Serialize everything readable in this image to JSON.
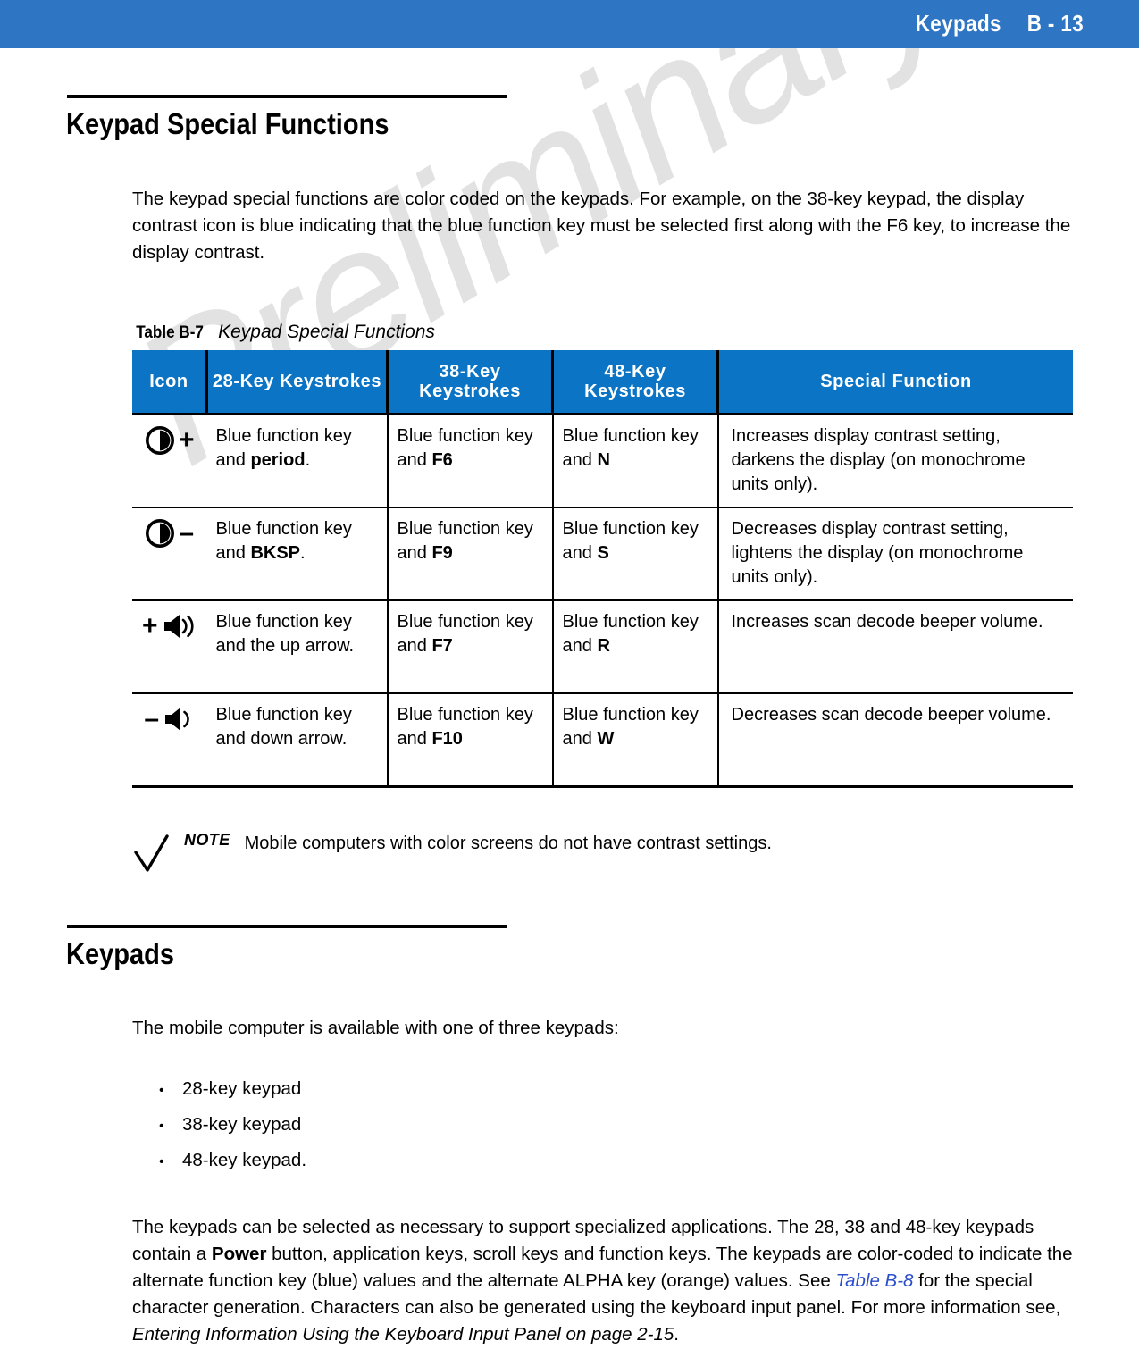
{
  "header": {
    "title": "Keypads",
    "page_number": "B - 13",
    "bar_color": "#2e76c4"
  },
  "watermark": {
    "text": "Preliminary"
  },
  "sections": {
    "special_functions": {
      "heading": "Keypad Special Functions",
      "intro": "The keypad special functions are color coded on the keypads. For example, on the 38-key keypad, the display contrast icon is blue indicating that the blue function key must be selected first along with the F6 key, to increase the display contrast."
    },
    "keypads": {
      "heading": "Keypads",
      "intro": "The mobile computer is available with one of three keypads:",
      "bullets": [
        "28-key keypad",
        "38-key keypad",
        "48-key keypad."
      ],
      "closing": {
        "part1": "The keypads can be selected as necessary to support specialized applications. The 28, 38 and 48-key keypads contain a ",
        "bold1": "Power",
        "part2": " button, application keys, scroll keys and function keys. The keypads are color-coded to indicate the alternate function key (blue) values and the alternate ALPHA key (orange) values. See ",
        "link1": "Table B-8",
        "part3": " for the special character generation. Characters can also be generated using the keyboard input panel. For more information see, ",
        "italic1": "Entering Information Using the Keyboard Input Panel on page 2-15",
        "part4": "."
      }
    }
  },
  "table": {
    "caption_label": "Table B-7",
    "caption_title": "Keypad Special Functions",
    "header_color": "#0b74c4",
    "columns": [
      "Icon",
      "28-Key Keystrokes",
      "38-Key Keystrokes",
      "48-Key Keystrokes",
      "Special Function"
    ],
    "rows": [
      {
        "icon_name": "contrast-increase-icon",
        "icon_sign": "+",
        "icon_sign_position": "right",
        "icon_kind": "contrast",
        "key28_prefix": "Blue function key and ",
        "key28_bold": "period",
        "key28_suffix": ".",
        "key38_prefix": "Blue function key and ",
        "key38_bold": "F6",
        "key38_suffix": "",
        "key48_prefix": "Blue function key and ",
        "key48_bold": "N",
        "key48_suffix": "",
        "function": "Increases display contrast setting, darkens the display (on monochrome units only)."
      },
      {
        "icon_name": "contrast-decrease-icon",
        "icon_sign": "–",
        "icon_sign_position": "right",
        "icon_kind": "contrast",
        "key28_prefix": "Blue function key and ",
        "key28_bold": "BKSP",
        "key28_suffix": ".",
        "key38_prefix": "Blue function key and ",
        "key38_bold": "F9",
        "key38_suffix": "",
        "key48_prefix": "Blue function key and ",
        "key48_bold": "S",
        "key48_suffix": "",
        "function": "Decreases display contrast setting, lightens the display (on monochrome units only)."
      },
      {
        "icon_name": "volume-increase-icon",
        "icon_sign": "+",
        "icon_sign_position": "left",
        "icon_kind": "speaker-loud",
        "key28_prefix": "Blue function key and the up arrow.",
        "key28_bold": "",
        "key28_suffix": "",
        "key38_prefix": "Blue function key and ",
        "key38_bold": "F7",
        "key38_suffix": "",
        "key48_prefix": "Blue function key and ",
        "key48_bold": "R",
        "key48_suffix": "",
        "function": "Increases scan decode beeper volume."
      },
      {
        "icon_name": "volume-decrease-icon",
        "icon_sign": "–",
        "icon_sign_position": "left",
        "icon_kind": "speaker-quiet",
        "key28_prefix": "Blue function key and down arrow.",
        "key28_bold": "",
        "key28_suffix": "",
        "key38_prefix": "Blue function key and ",
        "key38_bold": "F10",
        "key38_suffix": "",
        "key48_prefix": "Blue function key and ",
        "key48_bold": "W",
        "key48_suffix": "",
        "function": "Decreases scan decode beeper volume."
      }
    ]
  },
  "note": {
    "label": "NOTE",
    "text": "Mobile computers with color screens do not have contrast settings."
  }
}
